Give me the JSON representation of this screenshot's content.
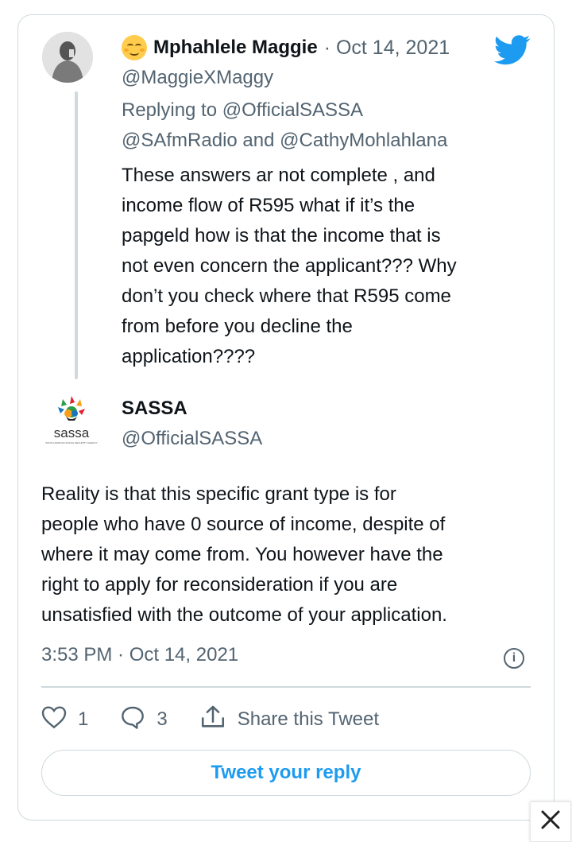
{
  "tweet1": {
    "name": "Mphahlele Maggie",
    "date": "· Oct 14, 2021",
    "handle": "@MaggieXMaggy",
    "replying_label": "Replying to",
    "replying_mention1": "@OfficialSASSA",
    "replying_mention2": "@SAfmRadio",
    "replying_and": "and",
    "replying_mention3": "@CathyMohlahlana",
    "body_lines": [
      "These answers ar not complete , and",
      "income flow of R595 what if it’s the",
      "papgeld how is that the income that is",
      "not even concern the applicant??? Why",
      "don’t you check where that R595 come",
      "from before you decline the",
      "application????"
    ]
  },
  "tweet2": {
    "name": "SASSA",
    "handle": "@OfficialSASSA",
    "logo_text": "sassa",
    "logo_tagline": "SOUTH AFRICAN SOCIAL SECURITY AGENCY",
    "body_lines": [
      "Reality is that this specific grant type is for",
      "people who have 0 source of income, despite of",
      "where it may come from. You however have the",
      "right to apply for reconsideration if you are",
      "unsatisfied with the outcome of your application."
    ],
    "timestamp": "3:53 PM · Oct 14, 2021"
  },
  "actions": {
    "like_count": "1",
    "reply_count": "3",
    "share_label": "Share this Tweet"
  },
  "reply_button_label": "Tweet your reply",
  "colors": {
    "accent": "#1d9bf0",
    "gray": "#536471",
    "border": "#cfd9de"
  },
  "icons": [
    "twitter-bird-icon",
    "heart-icon",
    "reply-bubble-icon",
    "share-icon",
    "info-icon",
    "close-icon"
  ]
}
